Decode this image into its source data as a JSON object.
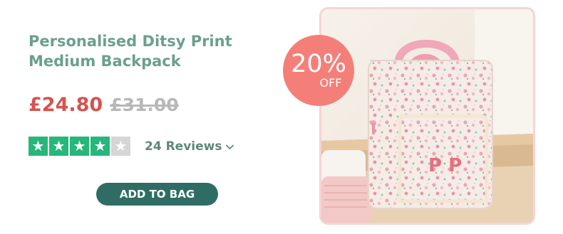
{
  "product": {
    "title": "Personalised Ditsy Print Medium Backpack",
    "price_now": "£24.80",
    "price_was": "£31.00"
  },
  "rating": {
    "stars": 4,
    "max_stars": 5,
    "reviews_label": "24 Reviews",
    "star_color": "#26b77a"
  },
  "cta": {
    "label": "ADD TO BAG",
    "color": "#2f6d64"
  },
  "badge": {
    "percent": "20%",
    "off": "OFF",
    "color": "#f47f79"
  },
  "image": {
    "monogram": "P P"
  },
  "icons": {
    "star": "star-icon",
    "dropdown": "chevron-down-icon"
  }
}
